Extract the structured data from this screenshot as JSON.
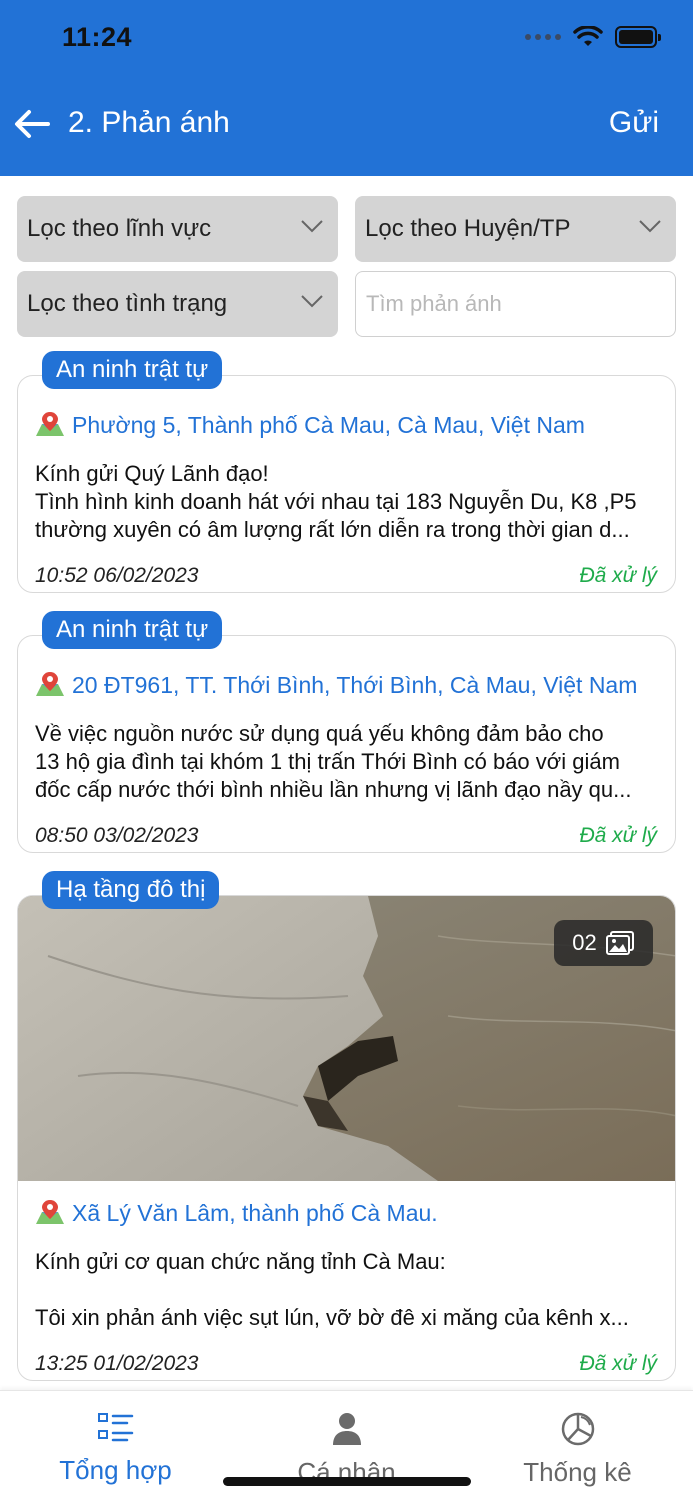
{
  "status_bar": {
    "time": "11:24"
  },
  "header": {
    "title": "2. Phản ánh",
    "send_label": "Gửi"
  },
  "filters": {
    "field": "Lọc theo lĩnh vực",
    "district": "Lọc theo Huyện/TP",
    "status": "Lọc theo tình trạng",
    "search_placeholder": "Tìm phản ánh"
  },
  "reports": [
    {
      "category": "An ninh trật tự",
      "location": "Phường 5, Thành phố Cà Mau, Cà Mau, Việt Nam",
      "lines": [
        "Kính gửi Quý Lãnh đạo!",
        "Tình hình kinh doanh hát với nhau tại 183 Nguyễn Du, K8 ,P5",
        "thường xuyên có âm lượng rất lớn diễn ra trong thời gian d..."
      ],
      "time": "10:52 06/02/2023",
      "status": "Đã xử lý"
    },
    {
      "category": "An ninh trật tự",
      "location": "20 ĐT961, TT. Thới Bình, Thới Bình, Cà Mau, Việt Nam",
      "lines": [
        "Về việc nguồn nước sử dụng quá yếu không đảm bảo cho",
        "13 hộ gia đình tại khóm 1 thị trấn Thới Bình có báo với giám",
        "đốc cấp nước thới bình nhiều lần nhưng vị lãnh đạo nầy qu..."
      ],
      "time": "08:50 03/02/2023",
      "status": "Đã xử lý"
    },
    {
      "category": "Hạ tầng đô thị",
      "photo_count": "02",
      "location": "Xã Lý Văn Lâm, thành phố Cà Mau.",
      "lines": [
        "Kính gửi cơ quan chức năng tỉnh Cà Mau:",
        "",
        "Tôi xin phản ánh việc sụt lún, vỡ bờ đê xi măng của kênh x..."
      ],
      "time": "13:25 01/02/2023",
      "status": "Đã xử lý"
    }
  ],
  "bottom_nav": [
    {
      "label": "Tổng hợp",
      "icon": "list-icon",
      "active": true
    },
    {
      "label": "Cá nhân",
      "icon": "person-icon",
      "active": false
    },
    {
      "label": "Thống kê",
      "icon": "pie-chart-icon",
      "active": false
    }
  ],
  "colors": {
    "primary": "#2272d6",
    "status_done": "#1fab4b",
    "filter_bg": "#d4d4d4"
  }
}
